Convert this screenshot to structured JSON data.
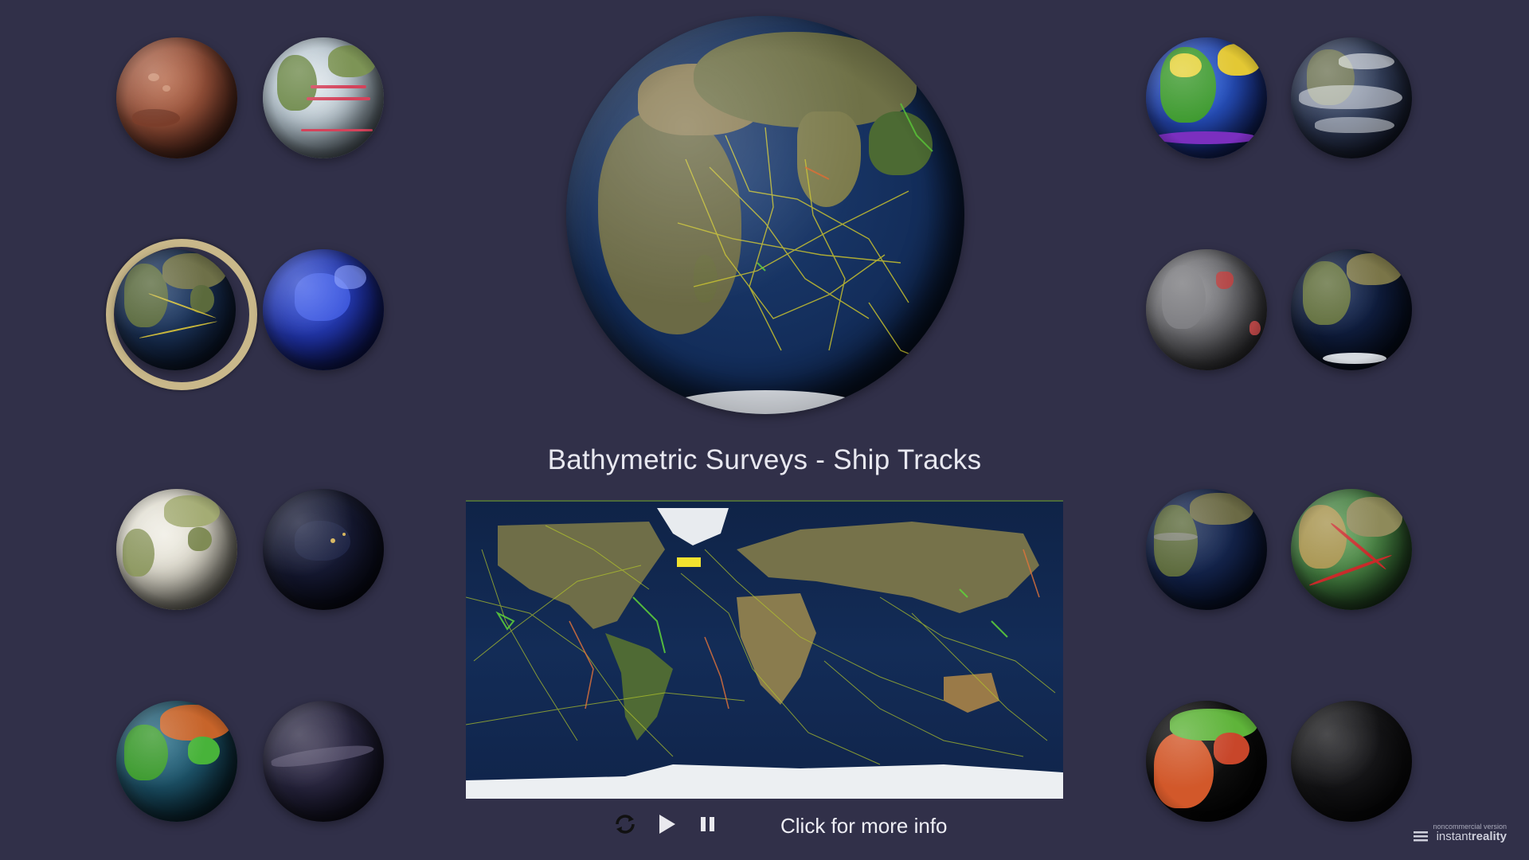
{
  "viewer": {
    "title": "Bathymetric Surveys - Ship Tracks",
    "info_link": "Click for more info",
    "watermark_small": "noncommercial version",
    "watermark_brand_light": "instant",
    "watermark_brand_bold": "reality"
  },
  "controls": {
    "reload_icon": "reload-icon",
    "play_icon": "play-icon",
    "pause_icon": "pause-icon"
  },
  "colors": {
    "background": "#313049",
    "selection_ring": "#c9b88a",
    "title_text": "#e8e8f0"
  },
  "globe_thumbnails": [
    {
      "id": "mars",
      "selected": false
    },
    {
      "id": "ocean-currents",
      "selected": false
    },
    {
      "id": "ship-tracks",
      "selected": true
    },
    {
      "id": "night-lights-blue",
      "selected": false
    },
    {
      "id": "snow-ice",
      "selected": false
    },
    {
      "id": "city-lights",
      "selected": false
    },
    {
      "id": "vegetation-ocean",
      "selected": false
    },
    {
      "id": "starfield",
      "selected": false
    },
    {
      "id": "sea-temperature",
      "selected": false
    },
    {
      "id": "clouds",
      "selected": false
    },
    {
      "id": "gray-highlight",
      "selected": false
    },
    {
      "id": "earth-night-stars",
      "selected": false
    },
    {
      "id": "earth-dark",
      "selected": false
    },
    {
      "id": "plate-tectonics",
      "selected": false
    },
    {
      "id": "land-temperature",
      "selected": false
    },
    {
      "id": "dark-sphere",
      "selected": false
    }
  ]
}
